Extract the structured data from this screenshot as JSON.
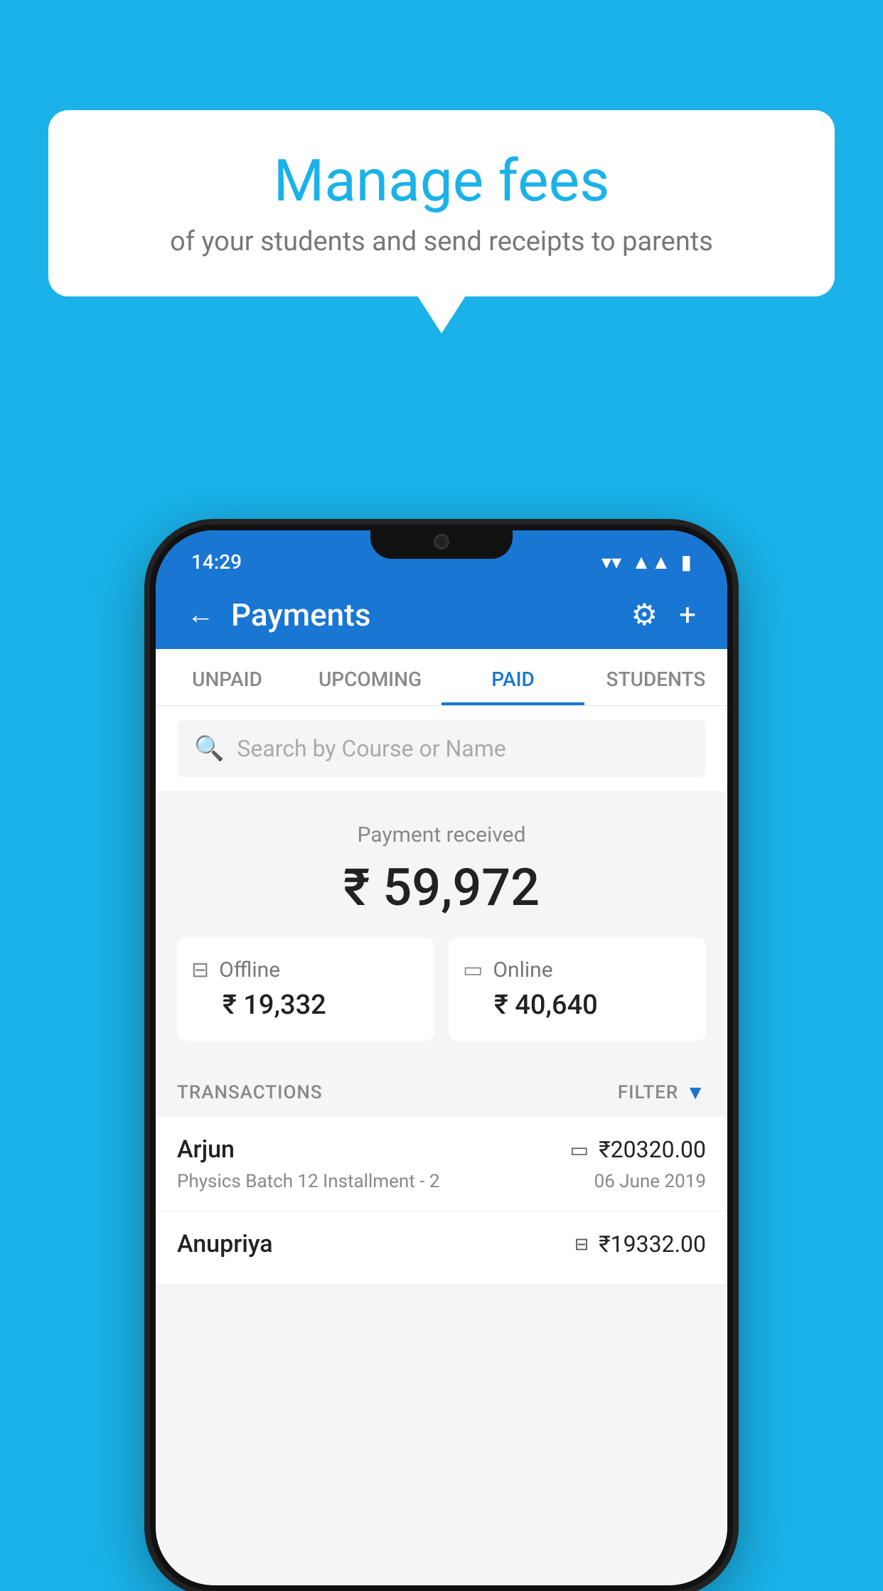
{
  "background_color": "#1ab2e8",
  "bubble": {
    "title": "Manage fees",
    "subtitle": "of your students and send receipts to parents"
  },
  "phone": {
    "status_bar": {
      "time": "14:29"
    },
    "header": {
      "title": "Payments",
      "back_label": "←",
      "gear_label": "⚙",
      "plus_label": "+"
    },
    "tabs": [
      {
        "label": "UNPAID",
        "active": false
      },
      {
        "label": "UPCOMING",
        "active": false
      },
      {
        "label": "PAID",
        "active": true
      },
      {
        "label": "STUDENTS",
        "active": false
      }
    ],
    "search": {
      "placeholder": "Search by Course or Name"
    },
    "payment_summary": {
      "label": "Payment received",
      "total": "₹ 59,972",
      "offline_label": "Offline",
      "offline_amount": "₹ 19,332",
      "online_label": "Online",
      "online_amount": "₹ 40,640"
    },
    "transactions_section": {
      "label": "TRANSACTIONS",
      "filter_label": "FILTER"
    },
    "transactions": [
      {
        "name": "Arjun",
        "amount": "₹20320.00",
        "payment_type": "card",
        "course": "Physics Batch 12 Installment - 2",
        "date": "06 June 2019"
      },
      {
        "name": "Anupriya",
        "amount": "₹19332.00",
        "payment_type": "cash",
        "course": "",
        "date": ""
      }
    ]
  }
}
